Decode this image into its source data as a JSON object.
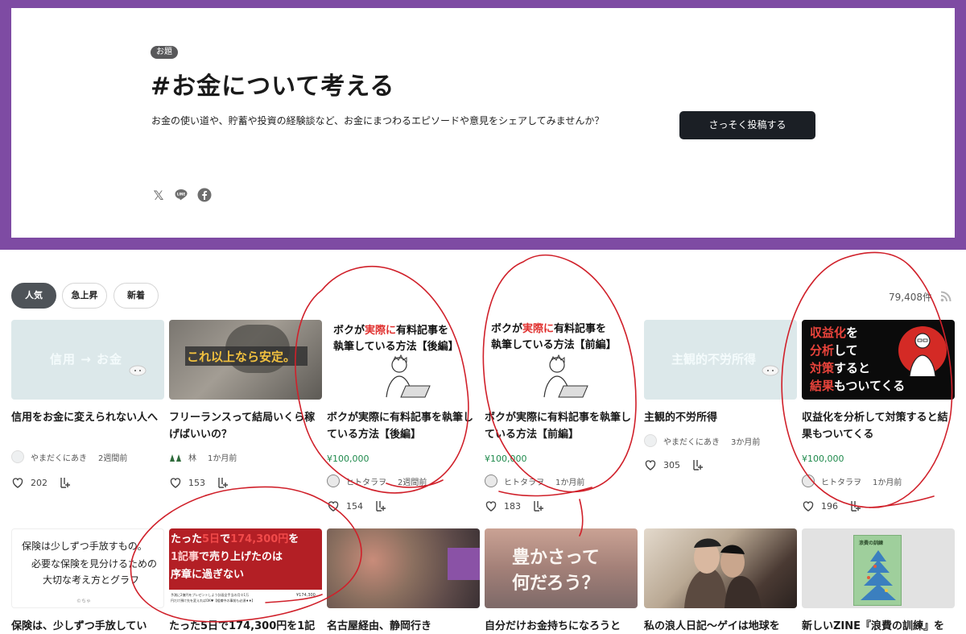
{
  "hero": {
    "badge": "お題",
    "title": "#お金について考える",
    "description": "お金の使い道や、貯蓄や投資の経験談など、お金にまつわるエピソードや意見をシェアしてみませんか？",
    "cta": "さっそく投稿する"
  },
  "tabs": [
    {
      "label": "人気",
      "active": true
    },
    {
      "label": "急上昇",
      "active": false
    },
    {
      "label": "新着",
      "active": false
    }
  ],
  "count": "79,408件",
  "cards": [
    {
      "title": "信用をお金に変えられない人へ",
      "thumb_text": "信用 → お金",
      "author": "やまだくにあき",
      "time": "2週間前",
      "likes": "202",
      "price": ""
    },
    {
      "title": "フリーランスって結局いくら稼げばいいの？",
      "thumb_text": "これ以上なら安定。",
      "author": "林",
      "time": "1か月前",
      "likes": "153",
      "price": ""
    },
    {
      "title": "ボクが実際に有料記事を執筆している方法【後編】",
      "thumb_line1_a": "ボクが",
      "thumb_line1_b": "実際に",
      "thumb_line1_c": "有料記事を",
      "thumb_line2": "執筆している方法【後編】",
      "author": "ヒトタラヲ",
      "time": "2週間前",
      "likes": "154",
      "price": "¥100,000"
    },
    {
      "title": "ボクが実際に有料記事を執筆している方法【前編】",
      "thumb_line1_a": "ボクが",
      "thumb_line1_b": "実際に",
      "thumb_line1_c": "有料記事を",
      "thumb_line2": "執筆している方法【前編】",
      "author": "ヒトタラヲ",
      "time": "1か月前",
      "likes": "183",
      "price": "¥100,000"
    },
    {
      "title": "主観的不労所得",
      "thumb_text": "主観的不労所得",
      "author": "やまだくにあき",
      "time": "3か月前",
      "likes": "305",
      "price": ""
    },
    {
      "title": "収益化を分析して対策すると結果もついてくる",
      "thumb_l1a": "収益化",
      "thumb_l1b": "を",
      "thumb_l2a": "分析",
      "thumb_l2b": "して",
      "thumb_l3a": "対策",
      "thumb_l3b": "すると",
      "thumb_l4a": "結果",
      "thumb_l4b": "もついてくる",
      "author": "ヒトタラヲ",
      "time": "1か月前",
      "likes": "196",
      "price": "¥100,000"
    }
  ],
  "cards_row2": [
    {
      "title": "保険は、少しずつ手放してい",
      "thumb_l1": "保険は少しずつ手放すもの。",
      "thumb_l2": "必要な保険を見分けるための",
      "thumb_l3": "大切な考え方とグラフ",
      "thumb_small": "©ちゃ"
    },
    {
      "title": "たった5日で174,300円を1記",
      "thumb_l1a": "たった",
      "thumb_l1b": "5日",
      "thumb_l1c": "で",
      "thumb_l1d": "174,300円",
      "thumb_l1e": "を",
      "thumb_l2a": "1記事",
      "thumb_l2b": "で売り上げたのは",
      "thumb_l3": "序章に過ぎない",
      "thumb_footer1": "予測に2億円をプレゼントしよう計画全手当の月々1万",
      "thumb_footer2": "円だけ預け先を変えればOK♥【組織中の事前も必須♦♦】",
      "thumb_price": "¥174,300"
    },
    {
      "title": "名古屋経由、静岡行き"
    },
    {
      "title": "自分だけお金持ちになろうと",
      "thumb_l1": "豊かさって",
      "thumb_l2": "何だろう？"
    },
    {
      "title": "私の浪人日記〜ゲイは地球を"
    },
    {
      "title": "新しいZINE『浪費の訓練』を",
      "thumb_book": "浪費の訓練"
    }
  ],
  "colors": {
    "hero_frame": "#7e4ba3",
    "cta_bg": "#1b1f25",
    "tab_active": "#4e5358",
    "price": "#1f8a4c",
    "ink": "#d0202a"
  }
}
